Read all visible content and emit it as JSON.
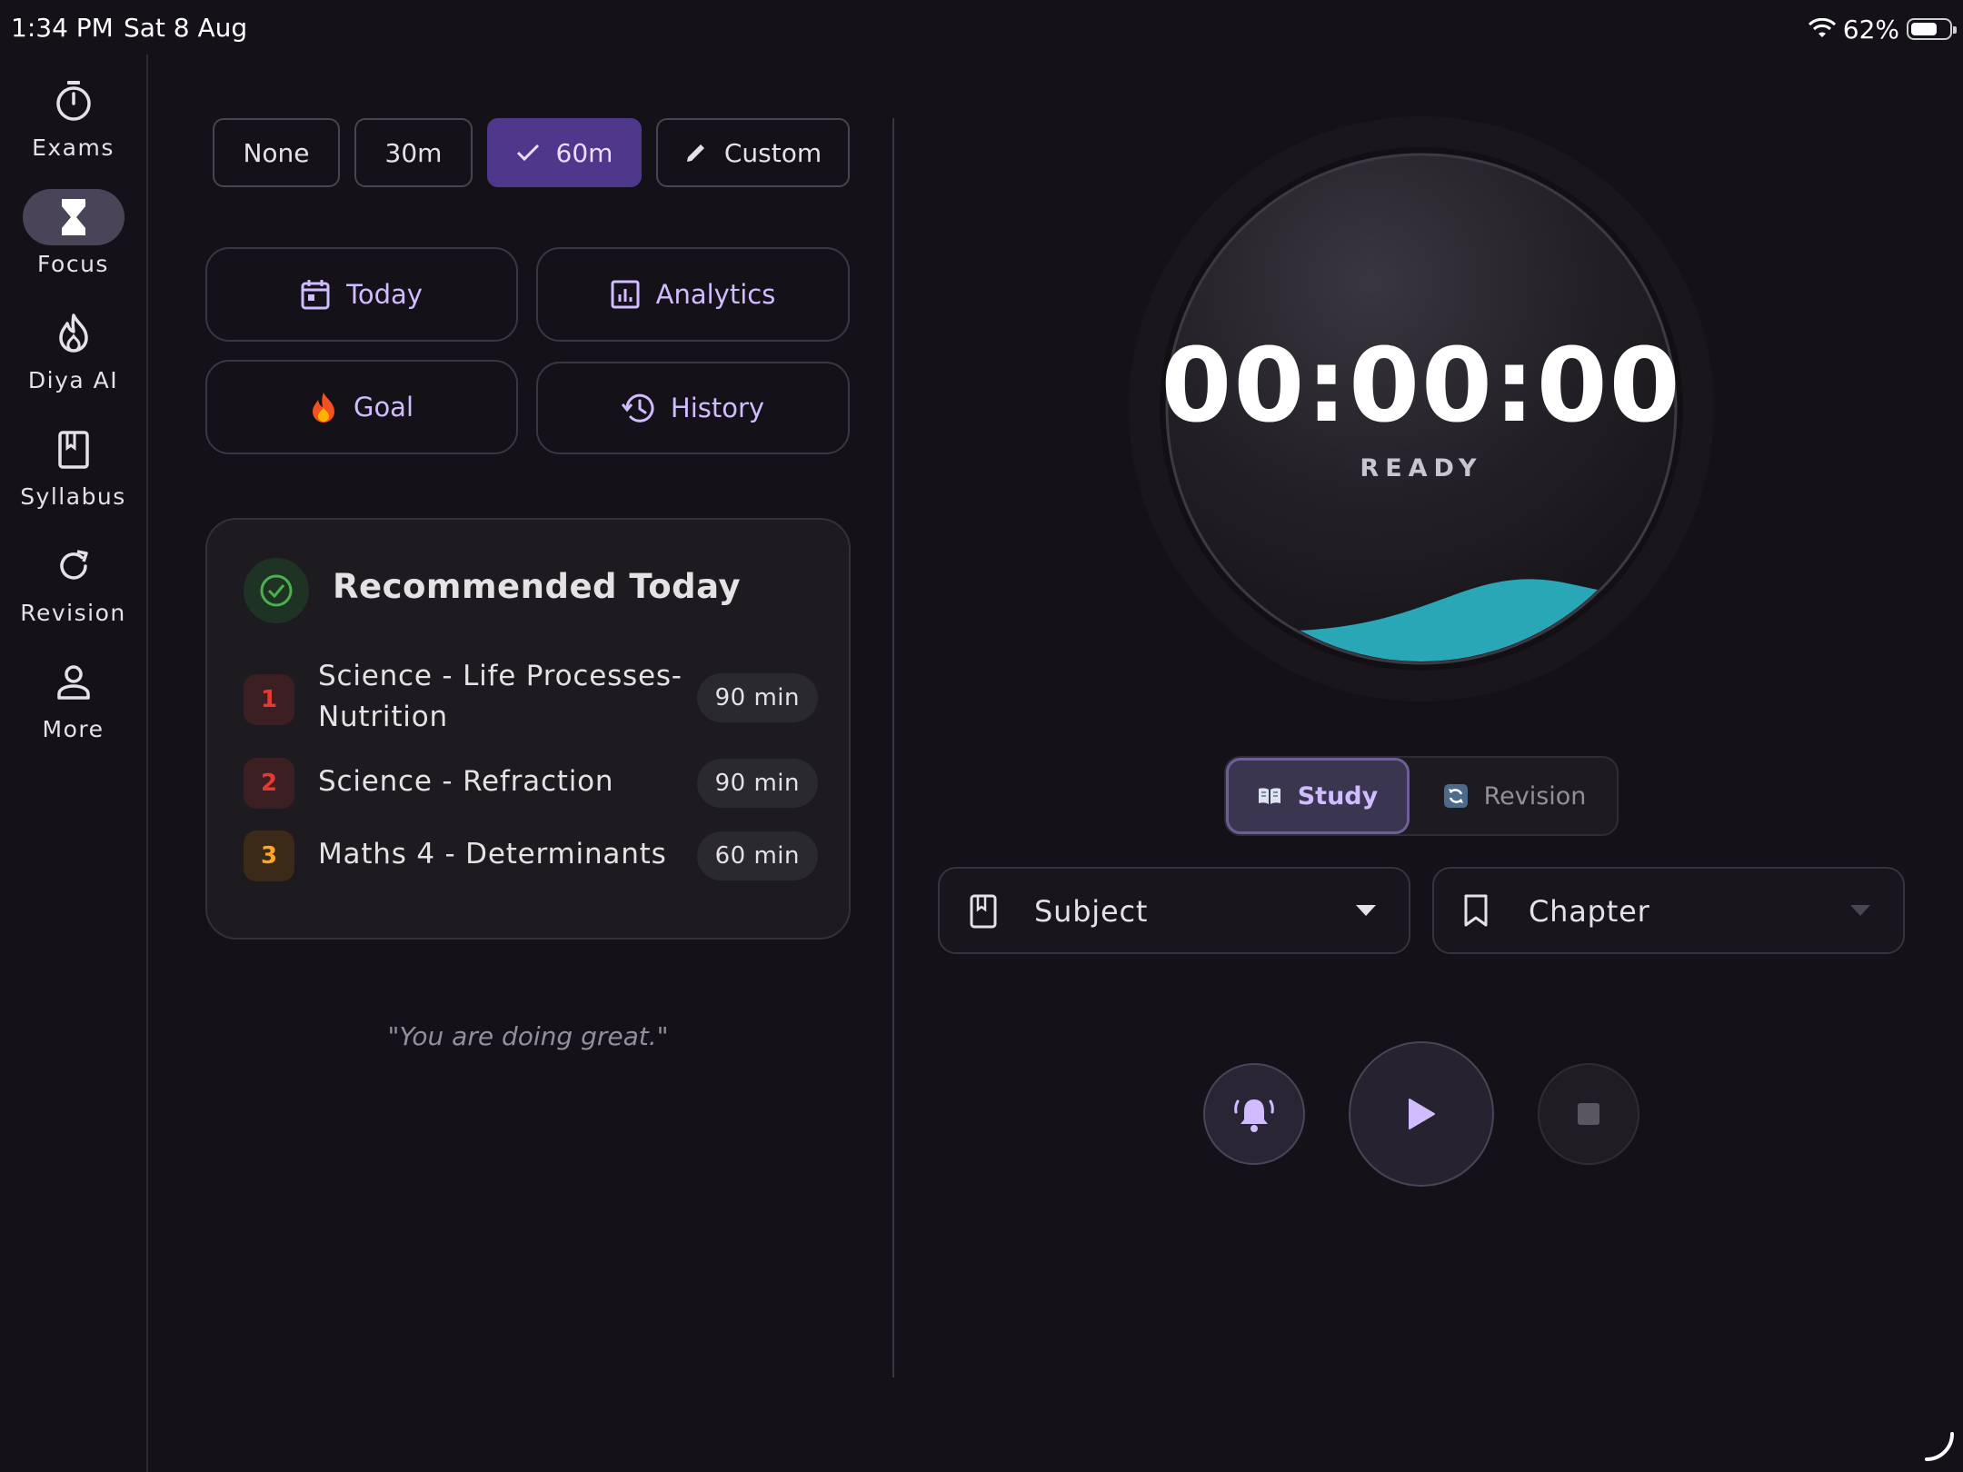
{
  "status_bar": {
    "time": "1:34 PM",
    "date": "Sat 8 Aug",
    "battery": "62%",
    "battery_level": 0.62
  },
  "nav": {
    "items": [
      {
        "label": "Exams",
        "icon": "timer-icon"
      },
      {
        "label": "Focus",
        "icon": "hourglass-icon",
        "active": true
      },
      {
        "label": "Diya AI",
        "icon": "flame-icon"
      },
      {
        "label": "Syllabus",
        "icon": "book-icon"
      },
      {
        "label": "Revision",
        "icon": "refresh-icon"
      },
      {
        "label": "More",
        "icon": "person-icon"
      }
    ]
  },
  "durations": {
    "options": [
      "None",
      "30m",
      "60m",
      "Custom"
    ],
    "selected": "60m"
  },
  "actions": {
    "today": "Today",
    "analytics": "Analytics",
    "goal": "Goal",
    "history": "History"
  },
  "recommended": {
    "title": "Recommended Today",
    "items": [
      {
        "rank": "1",
        "topic": "Science - Life Processes- Nutrition",
        "duration": "90 min"
      },
      {
        "rank": "2",
        "topic": "Science - Refraction",
        "duration": "90 min"
      },
      {
        "rank": "3",
        "topic": "Maths 4 - Determinants",
        "duration": "60 min"
      }
    ]
  },
  "quote": "\"You are doing great.\"",
  "timer": {
    "display": "00:00:00",
    "status": "READY"
  },
  "mode": {
    "study": "Study",
    "revision": "Revision",
    "selected": "Study"
  },
  "selectors": {
    "subject": "Subject",
    "chapter": "Chapter"
  },
  "colors": {
    "accent": "#d0bcff",
    "selected_chip": "#4f378b",
    "wave": "#2aa7b6",
    "background": "#141218"
  }
}
